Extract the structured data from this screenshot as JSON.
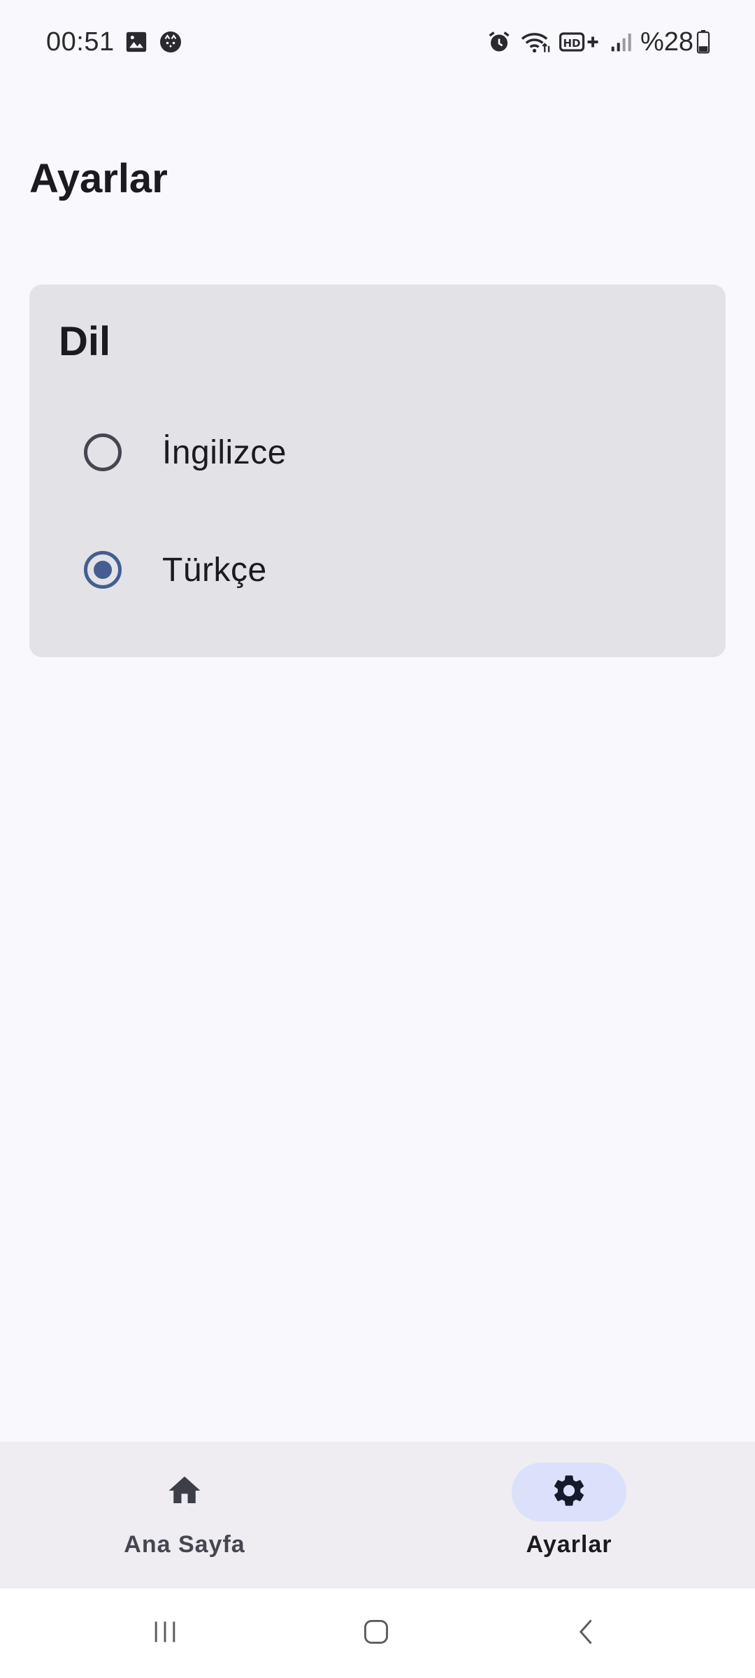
{
  "status_bar": {
    "time": "00:51",
    "battery": "%28",
    "left_icons": [
      "image-icon",
      "cat-face-icon"
    ],
    "right_icons": [
      "alarm-icon",
      "wifi-icon",
      "hd-plus-icon",
      "signal-icon",
      "battery-icon"
    ]
  },
  "page": {
    "title": "Ayarlar"
  },
  "language_card": {
    "title": "Dil",
    "options": [
      {
        "label": "İngilizce",
        "selected": false
      },
      {
        "label": "Türkçe",
        "selected": true
      }
    ]
  },
  "bottom_nav": {
    "items": [
      {
        "label": "Ana Sayfa",
        "icon": "home-icon",
        "active": false
      },
      {
        "label": "Ayarlar",
        "icon": "settings-icon",
        "active": true
      }
    ]
  },
  "colors": {
    "background": "#f9f8fd",
    "card": "#e3e2e7",
    "accent": "#445e91",
    "nav_indicator": "#dbe1fa",
    "nav_background": "#efedf2"
  },
  "system_nav": {
    "buttons": [
      "recents-icon",
      "home-button-icon",
      "back-icon"
    ]
  }
}
